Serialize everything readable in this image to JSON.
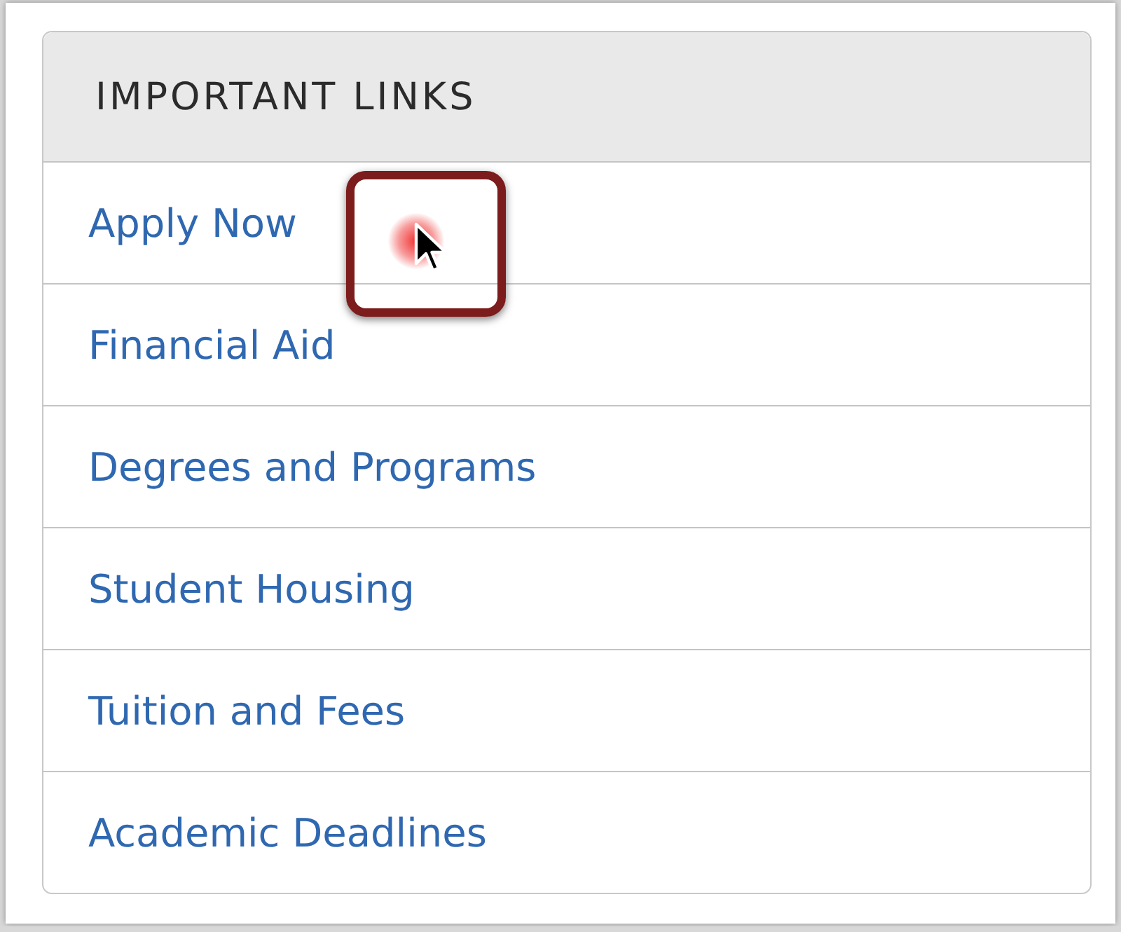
{
  "panel": {
    "title": "IMPORTANT LINKS",
    "links": [
      {
        "label": "Apply Now"
      },
      {
        "label": "Financial Aid"
      },
      {
        "label": "Degrees and Programs"
      },
      {
        "label": "Student Housing"
      },
      {
        "label": "Tuition and Fees"
      },
      {
        "label": "Academic Deadlines"
      }
    ]
  }
}
